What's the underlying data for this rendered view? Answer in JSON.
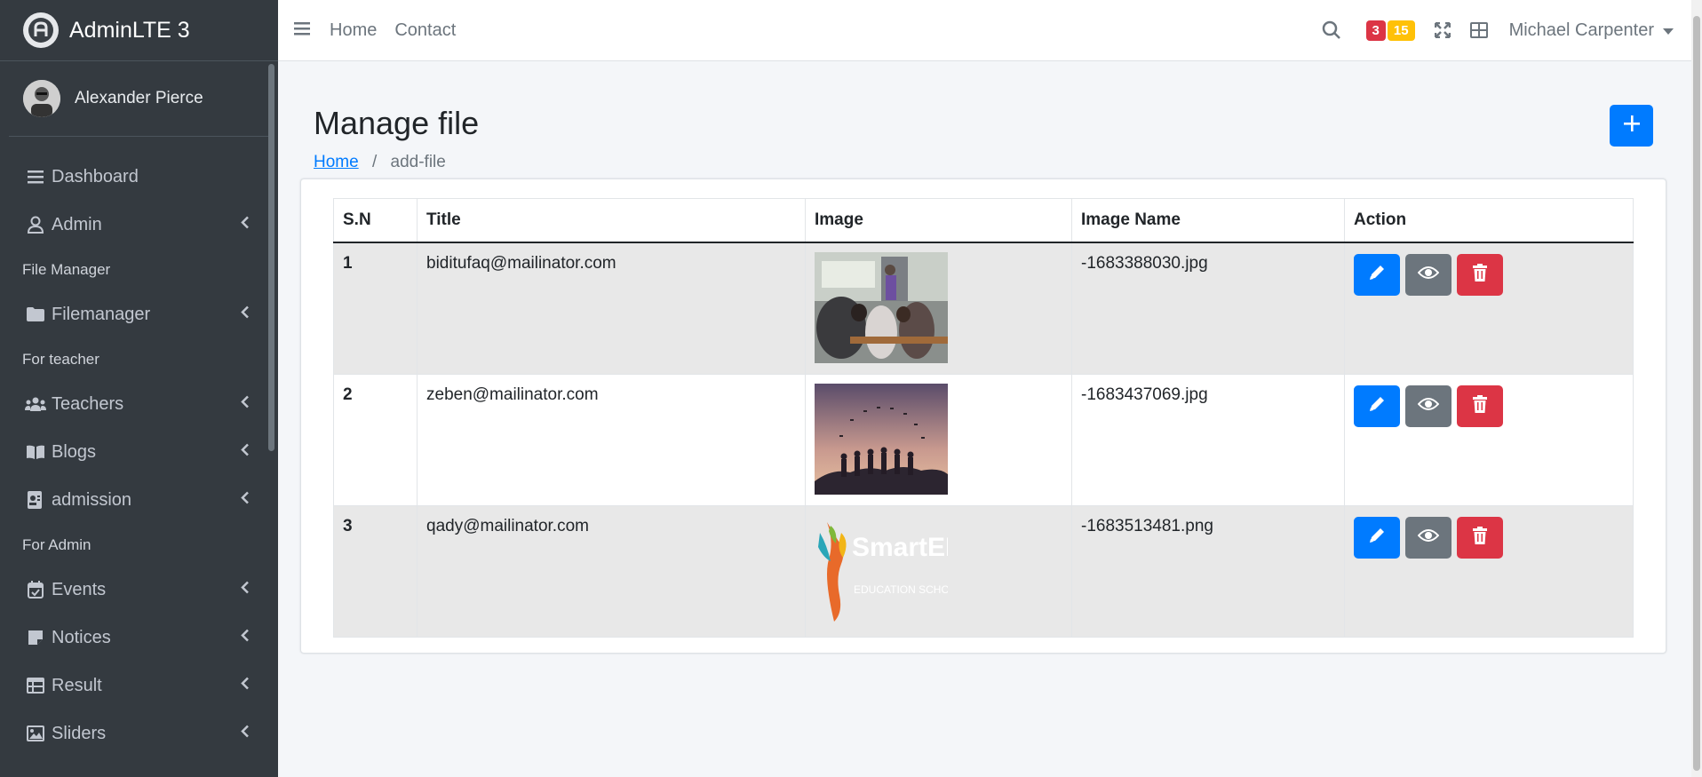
{
  "brand": {
    "title": "AdminLTE 3"
  },
  "user": {
    "name": "Alexander Pierce"
  },
  "sidebar": {
    "items": [
      {
        "label": "Dashboard",
        "icon": "menu-icon"
      },
      {
        "label": "Admin",
        "icon": "user-icon"
      },
      {
        "header": "File Manager"
      },
      {
        "label": "Filemanager",
        "icon": "folder-icon"
      },
      {
        "header": "For teacher"
      },
      {
        "label": "Teachers",
        "icon": "users-icon"
      },
      {
        "label": "Blogs",
        "icon": "book-icon"
      },
      {
        "label": "admission",
        "icon": "id-card-icon"
      },
      {
        "header": "For Admin"
      },
      {
        "label": "Events",
        "icon": "calendar-check-icon"
      },
      {
        "label": "Notices",
        "icon": "note-icon"
      },
      {
        "label": "Result",
        "icon": "table-icon"
      },
      {
        "label": "Sliders",
        "icon": "image-icon"
      }
    ]
  },
  "topbar": {
    "links": [
      "Home",
      "Contact"
    ],
    "badge_red": "3",
    "badge_yellow": "15",
    "user_name": "Michael Carpenter"
  },
  "page": {
    "title": "Manage file",
    "breadcrumb_home": "Home",
    "breadcrumb_current": "add-file"
  },
  "table": {
    "headers": [
      "S.N",
      "Title",
      "Image",
      "Image Name",
      "Action"
    ],
    "rows": [
      {
        "sn": "1",
        "title": "biditufaq@mailinator.com",
        "image_name": "-1683388030.jpg",
        "image": "classroom-photo"
      },
      {
        "sn": "2",
        "title": "zeben@mailinator.com",
        "image_name": "-1683437069.jpg",
        "image": "graduation-photo"
      },
      {
        "sn": "3",
        "title": "qady@mailinator.com",
        "image_name": "-1683513481.png",
        "image": "smartedu-logo",
        "logo_text": "SmartEDU",
        "logo_subtext": "EDUCATION SCHOOL"
      }
    ]
  },
  "colors": {
    "primary": "#007bff",
    "secondary": "#6c757d",
    "danger": "#dc3545",
    "warning": "#ffc107",
    "sidebar": "#343a40"
  }
}
